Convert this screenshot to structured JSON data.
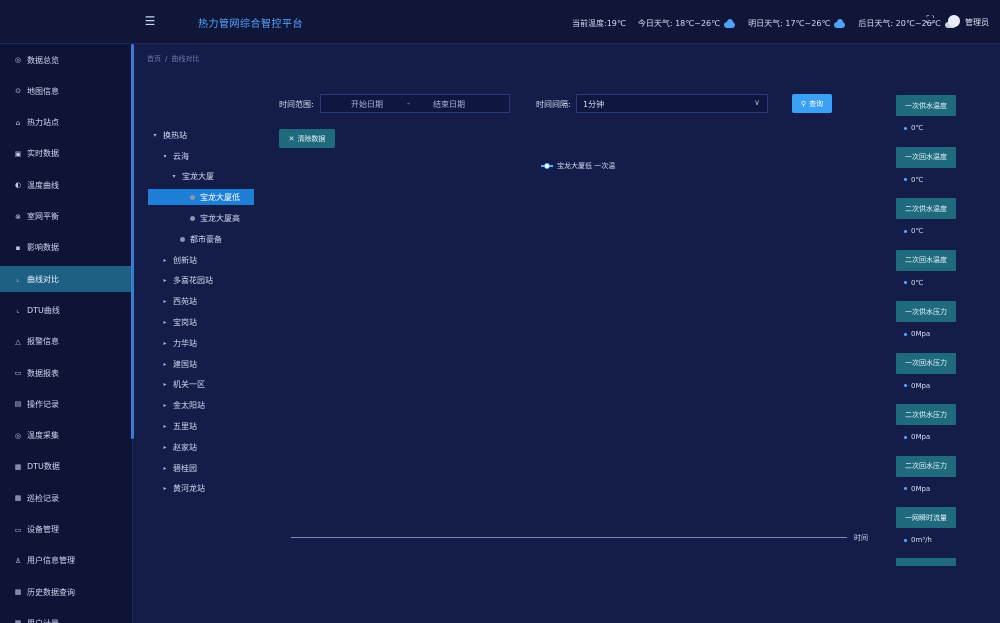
{
  "header": {
    "title": "热力管网综合智控平台",
    "weather": {
      "current_temp": "当前温度:19℃",
      "today": "今日天气: 18℃~26℃",
      "tomorrow": "明日天气: 17℃~26℃",
      "after_tomorrow": "后日天气: 20℃~26℃"
    },
    "user": "管理员"
  },
  "sidebar": {
    "items": [
      {
        "label": "数据总览",
        "icon": "dashboard-icon",
        "glyph": "◎"
      },
      {
        "label": "地图信息",
        "icon": "map-pin-icon",
        "glyph": "⊙"
      },
      {
        "label": "热力站点",
        "icon": "station-icon",
        "glyph": "⌂"
      },
      {
        "label": "实时数据",
        "icon": "monitor-icon",
        "glyph": "▣"
      },
      {
        "label": "温度曲线",
        "icon": "thermometer-icon",
        "glyph": "◐"
      },
      {
        "label": "室网平衡",
        "icon": "balance-icon",
        "glyph": "⊗"
      },
      {
        "label": "影响数据",
        "icon": "data-icon",
        "glyph": "▪"
      },
      {
        "label": "曲线对比",
        "icon": "line-chart-icon",
        "glyph": "⌞"
      },
      {
        "label": "DTU曲线",
        "icon": "dtu-chart-icon",
        "glyph": "⌞"
      },
      {
        "label": "报警信息",
        "icon": "bell-icon",
        "glyph": "△"
      },
      {
        "label": "数据报表",
        "icon": "report-icon",
        "glyph": "▭"
      },
      {
        "label": "操作记录",
        "icon": "log-icon",
        "glyph": "▤"
      },
      {
        "label": "温度采集",
        "icon": "collect-icon",
        "glyph": "◎"
      },
      {
        "label": "DTU数据",
        "icon": "dtu-data-icon",
        "glyph": "▦"
      },
      {
        "label": "巡检记录",
        "icon": "inspection-icon",
        "glyph": "▦"
      },
      {
        "label": "设备管理",
        "icon": "device-icon",
        "glyph": "▭"
      },
      {
        "label": "用户信息管理",
        "icon": "user-icon",
        "glyph": "♙"
      },
      {
        "label": "历史数据查询",
        "icon": "history-icon",
        "glyph": "▦"
      },
      {
        "label": "用户计量",
        "icon": "meter-icon",
        "glyph": "▦"
      }
    ],
    "active_index": 7
  },
  "breadcrumb": {
    "home": "首页",
    "separator": "/",
    "current": "曲线对比"
  },
  "tree": {
    "root": "换热站",
    "group_yunhai": "云海",
    "building": "宝龙大厦",
    "node_low": "宝龙大厦低",
    "node_high": "宝龙大厦高",
    "node_plaza": "都市豪备",
    "stations": [
      "创新站",
      "多喜花园站",
      "西苑站",
      "宝岗站",
      "力华站",
      "建国站",
      "机关一区",
      "金太阳站",
      "五里站",
      "赵家站",
      "碧桂园",
      "黄河龙站"
    ]
  },
  "filters": {
    "time_range_label": "时间范围:",
    "start_placeholder": "开始日期",
    "range_separator": "-",
    "end_placeholder": "结束日期",
    "interval_label": "时间间隔:",
    "interval_value": "1分钟",
    "query_button": "查询",
    "clear_button": "清除数据"
  },
  "chart_data": {
    "type": "line",
    "series": [
      {
        "name": "宝龙大厦低 一次温",
        "values": []
      }
    ],
    "x": [],
    "xlabel": "时间",
    "legend_position": "top-center",
    "grid": false
  },
  "cards": [
    {
      "title": "一次供水温度",
      "value": "0℃"
    },
    {
      "title": "一次回水温度",
      "value": "0℃"
    },
    {
      "title": "二次供水温度",
      "value": "0℃"
    },
    {
      "title": "二次回水温度",
      "value": "0℃"
    },
    {
      "title": "一次供水压力",
      "value": "0Mpa"
    },
    {
      "title": "一次回水压力",
      "value": "0Mpa"
    },
    {
      "title": "二次供水压力",
      "value": "0Mpa"
    },
    {
      "title": "二次回水压力",
      "value": "0Mpa"
    },
    {
      "title": "一网瞬时流量",
      "value": "0m³/h"
    }
  ],
  "colors": {
    "background": "#141d4a",
    "sidebar": "#0d1436",
    "accent": "#3ba1f5",
    "card": "#1f6b7d",
    "active_item": "#1e5f84"
  }
}
